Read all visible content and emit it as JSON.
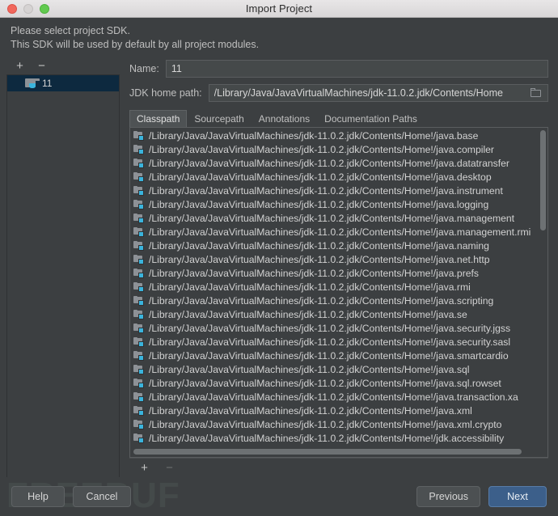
{
  "titlebar": {
    "title": "Import Project",
    "close_label": "close",
    "minimize_label": "minimize",
    "maximize_label": "maximize"
  },
  "header": {
    "line1": "Please select project SDK.",
    "line2": "This SDK will be used by default by all project modules."
  },
  "sdk_panel": {
    "add_label": "+",
    "remove_label": "−",
    "items": [
      {
        "label": "11",
        "selected": true
      }
    ]
  },
  "form": {
    "name_label": "Name:",
    "name_value": "11",
    "jdk_label": "JDK home path:",
    "jdk_value": "/Library/Java/JavaVirtualMachines/jdk-11.0.2.jdk/Contents/Home",
    "browse_icon": "folder-icon"
  },
  "tabs": [
    {
      "label": "Classpath",
      "active": true
    },
    {
      "label": "Sourcepath",
      "active": false
    },
    {
      "label": "Annotations",
      "active": false
    },
    {
      "label": "Documentation Paths",
      "active": false
    }
  ],
  "classpath": {
    "prefix": "/Library/Java/JavaVirtualMachines/jdk-11.0.2.jdk/Contents/Home!/",
    "entries": [
      "/Library/Java/JavaVirtualMachines/jdk-11.0.2.jdk/Contents/Home!/java.base",
      "/Library/Java/JavaVirtualMachines/jdk-11.0.2.jdk/Contents/Home!/java.compiler",
      "/Library/Java/JavaVirtualMachines/jdk-11.0.2.jdk/Contents/Home!/java.datatransfer",
      "/Library/Java/JavaVirtualMachines/jdk-11.0.2.jdk/Contents/Home!/java.desktop",
      "/Library/Java/JavaVirtualMachines/jdk-11.0.2.jdk/Contents/Home!/java.instrument",
      "/Library/Java/JavaVirtualMachines/jdk-11.0.2.jdk/Contents/Home!/java.logging",
      "/Library/Java/JavaVirtualMachines/jdk-11.0.2.jdk/Contents/Home!/java.management",
      "/Library/Java/JavaVirtualMachines/jdk-11.0.2.jdk/Contents/Home!/java.management.rmi",
      "/Library/Java/JavaVirtualMachines/jdk-11.0.2.jdk/Contents/Home!/java.naming",
      "/Library/Java/JavaVirtualMachines/jdk-11.0.2.jdk/Contents/Home!/java.net.http",
      "/Library/Java/JavaVirtualMachines/jdk-11.0.2.jdk/Contents/Home!/java.prefs",
      "/Library/Java/JavaVirtualMachines/jdk-11.0.2.jdk/Contents/Home!/java.rmi",
      "/Library/Java/JavaVirtualMachines/jdk-11.0.2.jdk/Contents/Home!/java.scripting",
      "/Library/Java/JavaVirtualMachines/jdk-11.0.2.jdk/Contents/Home!/java.se",
      "/Library/Java/JavaVirtualMachines/jdk-11.0.2.jdk/Contents/Home!/java.security.jgss",
      "/Library/Java/JavaVirtualMachines/jdk-11.0.2.jdk/Contents/Home!/java.security.sasl",
      "/Library/Java/JavaVirtualMachines/jdk-11.0.2.jdk/Contents/Home!/java.smartcardio",
      "/Library/Java/JavaVirtualMachines/jdk-11.0.2.jdk/Contents/Home!/java.sql",
      "/Library/Java/JavaVirtualMachines/jdk-11.0.2.jdk/Contents/Home!/java.sql.rowset",
      "/Library/Java/JavaVirtualMachines/jdk-11.0.2.jdk/Contents/Home!/java.transaction.xa",
      "/Library/Java/JavaVirtualMachines/jdk-11.0.2.jdk/Contents/Home!/java.xml",
      "/Library/Java/JavaVirtualMachines/jdk-11.0.2.jdk/Contents/Home!/java.xml.crypto",
      "/Library/Java/JavaVirtualMachines/jdk-11.0.2.jdk/Contents/Home!/jdk.accessibility"
    ]
  },
  "list_toolbar": {
    "add_label": "+",
    "remove_label": "−"
  },
  "footer": {
    "help_label": "Help",
    "cancel_label": "Cancel",
    "previous_label": "Previous",
    "next_label": "Next"
  },
  "watermark": {
    "text": "FREEBUF"
  },
  "colors": {
    "window_bg": "#3c3f41",
    "field_bg": "#45494a",
    "selection": "#0d293f",
    "accent": "#3c5f8a",
    "icon_badge": "#3ab4dd",
    "titlebar": "#e8e6e7"
  }
}
